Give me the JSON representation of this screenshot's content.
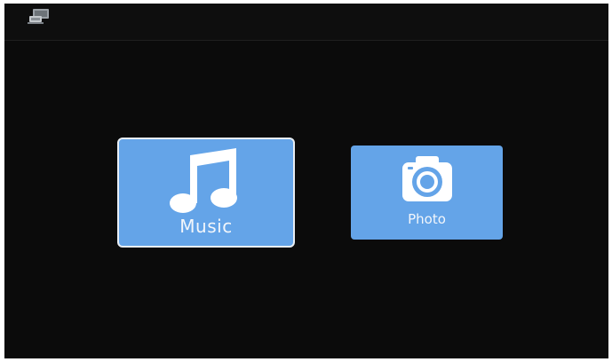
{
  "header": {
    "source_icon": "media-source-icon"
  },
  "menu": {
    "items": [
      {
        "label": "Music",
        "icon": "music-note-icon",
        "selected": true
      },
      {
        "label": "Photo",
        "icon": "camera-icon",
        "selected": false
      }
    ]
  },
  "colors": {
    "background": "#0b0b0b",
    "tile": "#64a4e8",
    "selected_border": "#e8eef4",
    "text": "#f2f6fb"
  }
}
